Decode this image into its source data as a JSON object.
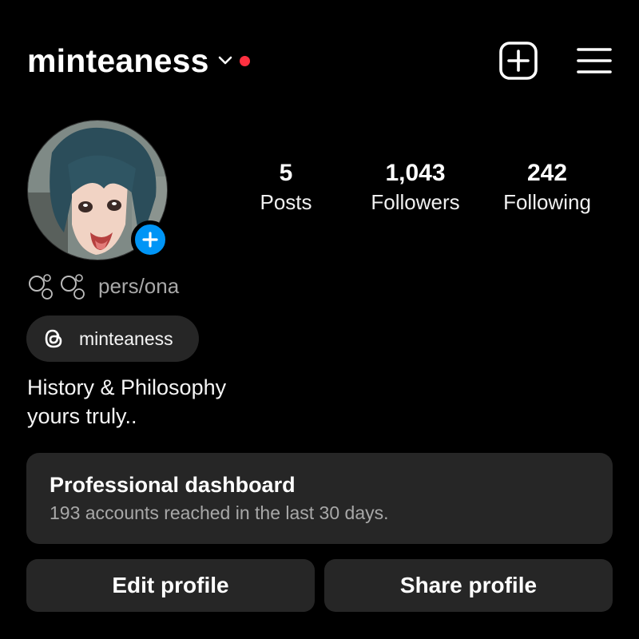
{
  "header": {
    "username": "minteaness",
    "switch_account_icon": "chevron-down-icon",
    "notification_color": "#ff3040",
    "new_post_icon": "plus-square-icon",
    "menu_icon": "hamburger-menu-icon"
  },
  "profile": {
    "avatar_icon": "avatar-illustration",
    "add_story_icon": "plus-icon",
    "add_story_color": "#0095f6",
    "stats": [
      {
        "value": "5",
        "label": "Posts"
      },
      {
        "value": "1,043",
        "label": "Followers"
      },
      {
        "value": "242",
        "label": "Following"
      }
    ],
    "pronouns": "pers/ona",
    "threads_handle": "minteaness",
    "bio_lines": [
      "History & Philosophy",
      "yours truly.."
    ]
  },
  "dashboard": {
    "title": "Professional dashboard",
    "subtitle": "193 accounts reached in the last 30 days."
  },
  "actions": {
    "edit_label": "Edit profile",
    "share_label": "Share profile"
  }
}
